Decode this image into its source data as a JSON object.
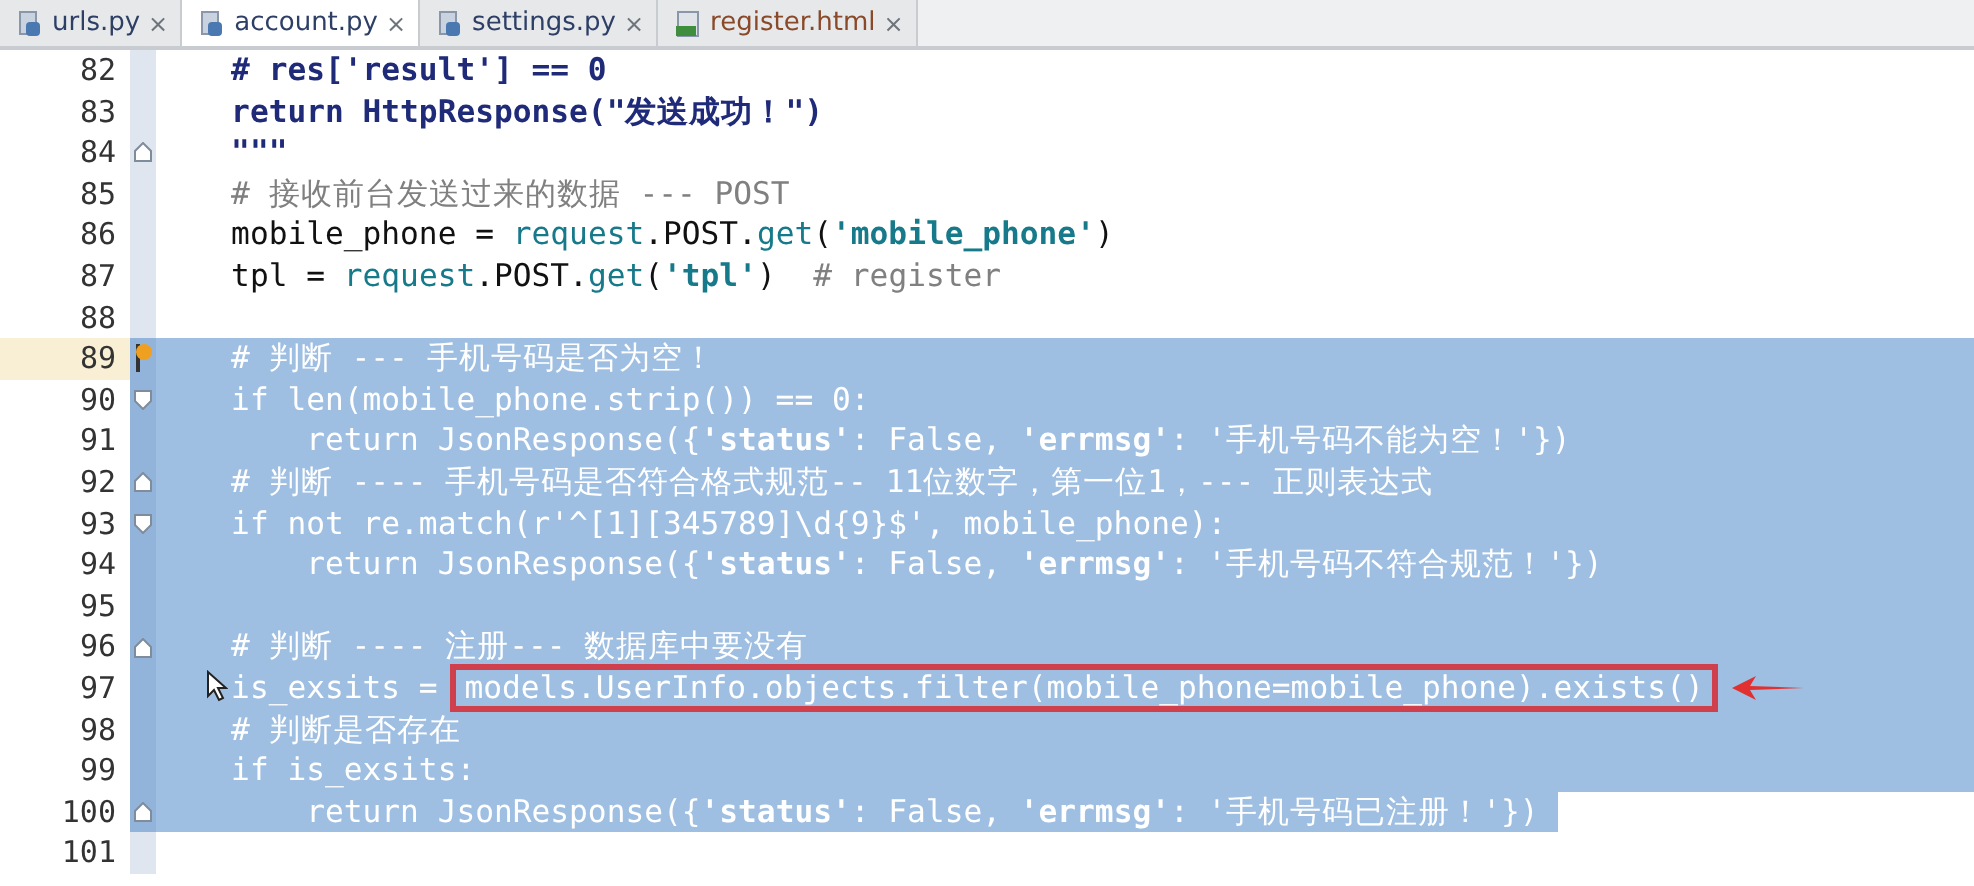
{
  "tabs": [
    {
      "label": "urls.py",
      "kind": "python",
      "selected": false,
      "close": "×"
    },
    {
      "label": "account.py",
      "kind": "python",
      "selected": true,
      "close": "×"
    },
    {
      "label": "settings.py",
      "kind": "python",
      "selected": false,
      "close": "×"
    },
    {
      "label": "register.html",
      "kind": "html",
      "selected": false,
      "close": "×"
    }
  ],
  "lines": [
    {
      "number": "82",
      "selected": false,
      "tokens": [
        {
          "text": "    # res['result'] == 0",
          "kind": "docstring"
        }
      ]
    },
    {
      "number": "83",
      "selected": false,
      "tokens": [
        {
          "text": "    return HttpResponse(\"发送成功！\")",
          "kind": "docstring"
        }
      ]
    },
    {
      "number": "84",
      "selected": false,
      "fold_end": true,
      "tokens": [
        {
          "text": "    \"\"\"",
          "kind": "docstring"
        }
      ]
    },
    {
      "number": "85",
      "selected": false,
      "tokens": [
        {
          "text": "    # 接收前台发送过来的数据 --- POST",
          "kind": "comment"
        }
      ]
    },
    {
      "number": "86",
      "selected": false,
      "tokens": [
        {
          "text": "    mobile_phone = ",
          "kind": "plain"
        },
        {
          "text": "request",
          "kind": "name"
        },
        {
          "text": ".POST.",
          "kind": "plain"
        },
        {
          "text": "get",
          "kind": "name"
        },
        {
          "text": "(",
          "kind": "plain"
        },
        {
          "text": "'mobile_phone'",
          "kind": "string"
        },
        {
          "text": ")",
          "kind": "plain"
        }
      ]
    },
    {
      "number": "87",
      "selected": false,
      "tokens": [
        {
          "text": "    tpl = ",
          "kind": "plain"
        },
        {
          "text": "request",
          "kind": "name"
        },
        {
          "text": ".POST.",
          "kind": "plain"
        },
        {
          "text": "get",
          "kind": "name"
        },
        {
          "text": "(",
          "kind": "plain"
        },
        {
          "text": "'tpl'",
          "kind": "string"
        },
        {
          "text": ")  ",
          "kind": "plain"
        },
        {
          "text": "# register",
          "kind": "comment"
        }
      ]
    },
    {
      "number": "88",
      "selected": false
    },
    {
      "number": "89",
      "selected": true,
      "current": true,
      "tokens": [
        {
          "text": "    # 判断 --- 手机号码是否为空！",
          "kind": "comment"
        }
      ]
    },
    {
      "number": "90",
      "selected": true,
      "fold_start": true,
      "tokens": [
        {
          "text": "    if len(mobile_phone.strip()) == 0:",
          "kind": "plain"
        }
      ]
    },
    {
      "number": "91",
      "selected": true,
      "tokens": [
        {
          "text": "        return JsonResponse({",
          "kind": "plain"
        },
        {
          "text": "'status'",
          "kind": "string"
        },
        {
          "text": ": False, ",
          "kind": "plain"
        },
        {
          "text": "'errmsg'",
          "kind": "string"
        },
        {
          "text": ": '手机号码不能为空！'})",
          "kind": "plain"
        }
      ]
    },
    {
      "number": "92",
      "selected": true,
      "fold_end": true,
      "tokens": [
        {
          "text": "    # 判断 ---- 手机号码是否符合格式规范-- 11位数字，第一位1，--- 正则表达式",
          "kind": "comment"
        }
      ]
    },
    {
      "number": "93",
      "selected": true,
      "fold_start": true,
      "tokens": [
        {
          "text": "    if not re.match(r'^[1][345789]\\d{9}$', mobile_phone):",
          "kind": "plain"
        }
      ]
    },
    {
      "number": "94",
      "selected": true,
      "tokens": [
        {
          "text": "        return JsonResponse({",
          "kind": "plain"
        },
        {
          "text": "'status'",
          "kind": "string"
        },
        {
          "text": ": False, ",
          "kind": "plain"
        },
        {
          "text": "'errmsg'",
          "kind": "string"
        },
        {
          "text": ": '手机号码不符合规范！'})",
          "kind": "plain"
        }
      ]
    },
    {
      "number": "95",
      "selected": true
    },
    {
      "number": "96",
      "selected": true,
      "fold_end": true,
      "tokens": [
        {
          "text": "    # 判断 ---- 注册--- 数据库中要没有",
          "kind": "comment"
        }
      ]
    },
    {
      "number": "97",
      "selected": true,
      "arrow": true,
      "tokens": [
        {
          "text": "    is_exsits = ",
          "kind": "plain"
        },
        {
          "text": "models.UserInfo.objects.filter(mobile_phone=mobile_phone).exists()",
          "kind": "plain",
          "boxed": true
        }
      ]
    },
    {
      "number": "98",
      "selected": true,
      "tokens": [
        {
          "text": "    # 判断是否存在",
          "kind": "comment"
        }
      ]
    },
    {
      "number": "99",
      "selected": true,
      "tokens": [
        {
          "text": "    if is_exsits:",
          "kind": "plain"
        }
      ]
    },
    {
      "number": "100",
      "selected": true,
      "partial": true,
      "fold_end": true,
      "tokens": [
        {
          "text": "        return JsonResponse({",
          "kind": "plain"
        },
        {
          "text": "'status'",
          "kind": "string"
        },
        {
          "text": ": False, ",
          "kind": "plain"
        },
        {
          "text": "'errmsg'",
          "kind": "string"
        },
        {
          "text": ": '手机号码已注册！'}) ",
          "kind": "plain"
        }
      ]
    },
    {
      "number": "101",
      "selected": false
    }
  ]
}
